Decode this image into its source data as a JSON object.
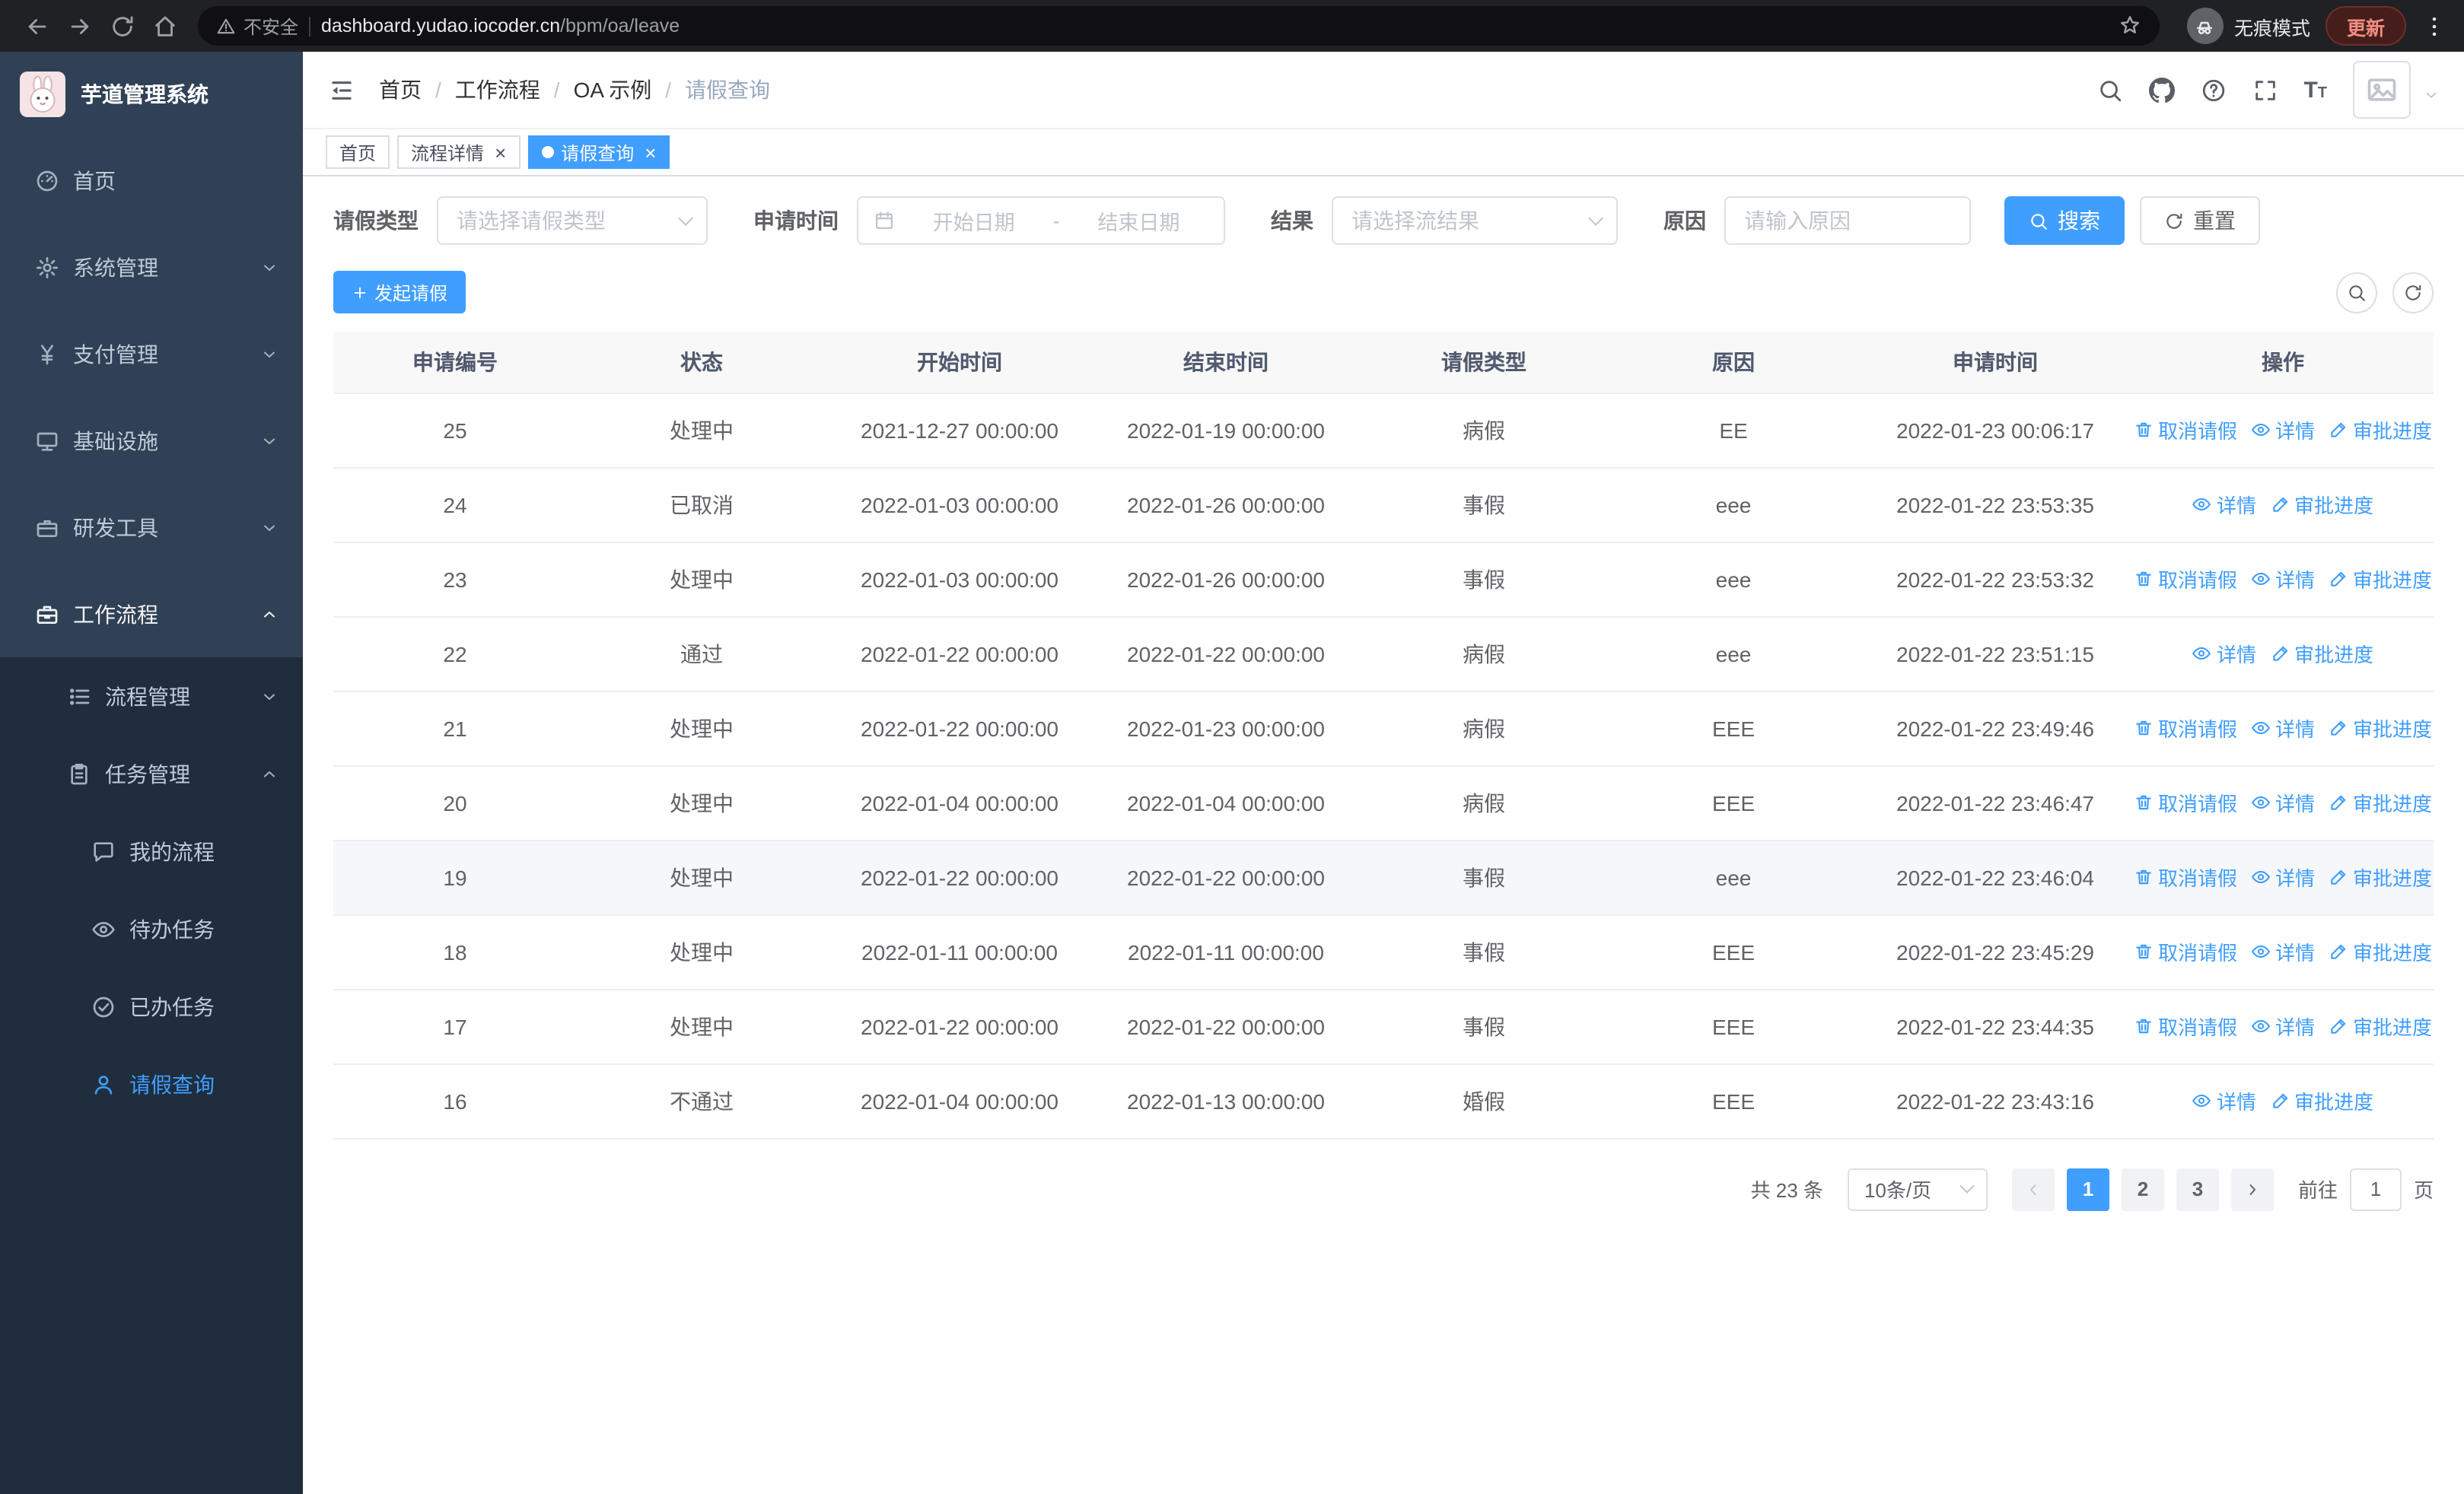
{
  "browser": {
    "security_warning": "不安全",
    "url_domain": "dashboard.yudao.iocoder.cn",
    "url_path": "/bpm/oa/leave",
    "incognito_label": "无痕模式",
    "update_label": "更新"
  },
  "sidebar": {
    "logo_title": "芋道管理系统",
    "items": [
      {
        "label": "首页",
        "icon": "dashboard",
        "expandable": false,
        "expanded": false,
        "active": false
      },
      {
        "label": "系统管理",
        "icon": "gear",
        "expandable": true,
        "expanded": false,
        "active": false
      },
      {
        "label": "支付管理",
        "icon": "yen",
        "expandable": true,
        "expanded": false,
        "active": false
      },
      {
        "label": "基础设施",
        "icon": "infra",
        "expandable": true,
        "expanded": false,
        "active": false
      },
      {
        "label": "研发工具",
        "icon": "tool",
        "expandable": true,
        "expanded": false,
        "active": false
      },
      {
        "label": "工作流程",
        "icon": "briefcase",
        "expandable": true,
        "expanded": true,
        "active": true
      }
    ],
    "workflow_children": [
      {
        "label": "流程管理",
        "icon": "flow",
        "expandable": true,
        "expanded": false,
        "children": []
      },
      {
        "label": "任务管理",
        "icon": "tasks",
        "expandable": true,
        "expanded": true,
        "children": [
          {
            "label": "我的流程",
            "icon": "chat",
            "active": false
          },
          {
            "label": "待办任务",
            "icon": "eye",
            "active": false
          },
          {
            "label": "已办任务",
            "icon": "done",
            "active": false
          },
          {
            "label": "请假查询",
            "icon": "user",
            "active": true
          }
        ]
      }
    ]
  },
  "header": {
    "breadcrumb": [
      "首页",
      "工作流程",
      "OA 示例",
      "请假查询"
    ],
    "separator": "/"
  },
  "tabs": [
    {
      "label": "首页",
      "closable": false,
      "active": false
    },
    {
      "label": "流程详情",
      "closable": true,
      "active": false
    },
    {
      "label": "请假查询",
      "closable": true,
      "active": true
    }
  ],
  "filters": {
    "leave_type_label": "请假类型",
    "leave_type_placeholder": "请选择请假类型",
    "apply_time_label": "申请时间",
    "date_start_placeholder": "开始日期",
    "date_separator": "-",
    "date_end_placeholder": "结束日期",
    "result_label": "结果",
    "result_placeholder": "请选择流结果",
    "reason_label": "原因",
    "reason_placeholder": "请输入原因",
    "search_label": "搜索",
    "reset_label": "重置"
  },
  "toolbar": {
    "create_label": "发起请假"
  },
  "table": {
    "columns": [
      "申请编号",
      "状态",
      "开始时间",
      "结束时间",
      "请假类型",
      "原因",
      "申请时间",
      "操作"
    ],
    "actions": {
      "cancel": "取消请假",
      "detail": "详情",
      "progress": "审批进度"
    },
    "rows": [
      {
        "id": "25",
        "status": "处理中",
        "start": "2021-12-27 00:00:00",
        "end": "2022-01-19 00:00:00",
        "type": "病假",
        "reason": "EE",
        "applied": "2022-01-23 00:06:17",
        "cancelable": true,
        "hover": false
      },
      {
        "id": "24",
        "status": "已取消",
        "start": "2022-01-03 00:00:00",
        "end": "2022-01-26 00:00:00",
        "type": "事假",
        "reason": "eee",
        "applied": "2022-01-22 23:53:35",
        "cancelable": false,
        "hover": false
      },
      {
        "id": "23",
        "status": "处理中",
        "start": "2022-01-03 00:00:00",
        "end": "2022-01-26 00:00:00",
        "type": "事假",
        "reason": "eee",
        "applied": "2022-01-22 23:53:32",
        "cancelable": true,
        "hover": false
      },
      {
        "id": "22",
        "status": "通过",
        "start": "2022-01-22 00:00:00",
        "end": "2022-01-22 00:00:00",
        "type": "病假",
        "reason": "eee",
        "applied": "2022-01-22 23:51:15",
        "cancelable": false,
        "hover": false
      },
      {
        "id": "21",
        "status": "处理中",
        "start": "2022-01-22 00:00:00",
        "end": "2022-01-23 00:00:00",
        "type": "病假",
        "reason": "EEE",
        "applied": "2022-01-22 23:49:46",
        "cancelable": true,
        "hover": false
      },
      {
        "id": "20",
        "status": "处理中",
        "start": "2022-01-04 00:00:00",
        "end": "2022-01-04 00:00:00",
        "type": "病假",
        "reason": "EEE",
        "applied": "2022-01-22 23:46:47",
        "cancelable": true,
        "hover": false
      },
      {
        "id": "19",
        "status": "处理中",
        "start": "2022-01-22 00:00:00",
        "end": "2022-01-22 00:00:00",
        "type": "事假",
        "reason": "eee",
        "applied": "2022-01-22 23:46:04",
        "cancelable": true,
        "hover": true
      },
      {
        "id": "18",
        "status": "处理中",
        "start": "2022-01-11 00:00:00",
        "end": "2022-01-11 00:00:00",
        "type": "事假",
        "reason": "EEE",
        "applied": "2022-01-22 23:45:29",
        "cancelable": true,
        "hover": false
      },
      {
        "id": "17",
        "status": "处理中",
        "start": "2022-01-22 00:00:00",
        "end": "2022-01-22 00:00:00",
        "type": "事假",
        "reason": "EEE",
        "applied": "2022-01-22 23:44:35",
        "cancelable": true,
        "hover": false
      },
      {
        "id": "16",
        "status": "不通过",
        "start": "2022-01-04 00:00:00",
        "end": "2022-01-13 00:00:00",
        "type": "婚假",
        "reason": "EEE",
        "applied": "2022-01-22 23:43:16",
        "cancelable": false,
        "hover": false
      }
    ]
  },
  "pagination": {
    "total_label": "共 23 条",
    "page_size_label": "10条/页",
    "pages": [
      "1",
      "2",
      "3"
    ],
    "active_page": "1",
    "goto_label": "前往",
    "goto_value": "1",
    "page_unit_label": "页"
  },
  "colors": {
    "primary": "#409eff",
    "sidebar_bg": "#304156",
    "sidebar_sub_bg": "#1f2d3d"
  }
}
